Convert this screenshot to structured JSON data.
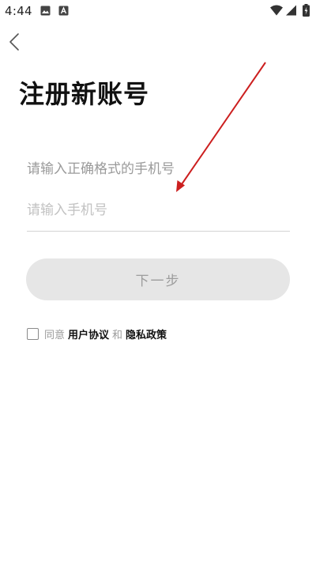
{
  "status_bar": {
    "time": "4:44",
    "left_icons": [
      "image-notification-icon",
      "app-notification-icon"
    ],
    "right_icons": [
      "wifi-icon",
      "signal-icon",
      "battery-icon"
    ]
  },
  "nav": {
    "back_icon": "chevron-left-icon"
  },
  "page": {
    "title": "注册新账号",
    "hint": "请输入正确格式的手机号"
  },
  "phone": {
    "placeholder": "请输入手机号",
    "value": ""
  },
  "next_button": {
    "label": "下一步"
  },
  "agreement": {
    "prefix": "同意",
    "user_agreement": "用户协议",
    "conjunction": "和",
    "privacy_policy": "隐私政策",
    "checked": false
  },
  "annotation": {
    "color": "#cc1f1f"
  }
}
